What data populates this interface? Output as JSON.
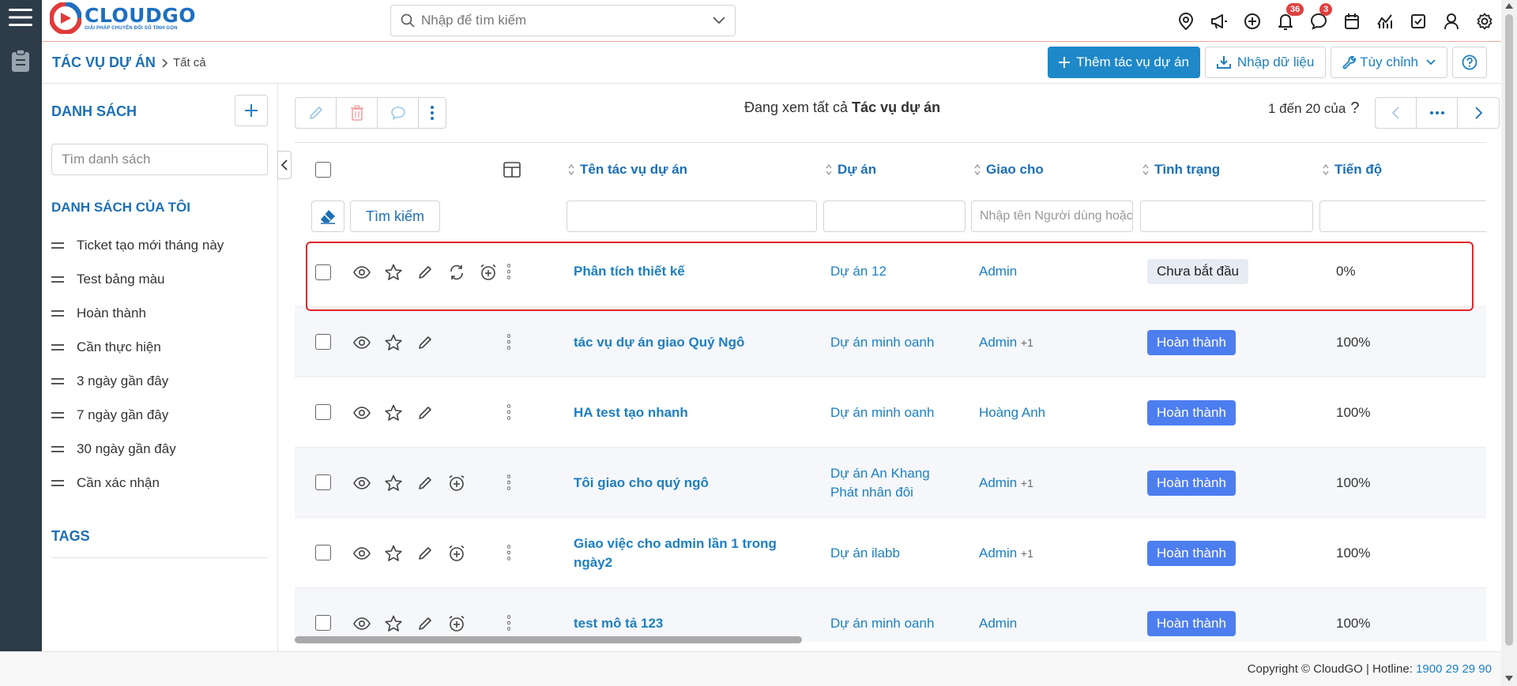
{
  "app": {
    "logo_title": "CLOUDGO",
    "logo_subtitle": "GIẢI PHÁP CHUYỂN ĐỔI SỐ TINH GỌN"
  },
  "header": {
    "search_placeholder": "Nhập để tìm kiếm",
    "icons": [
      "location-icon",
      "megaphone-icon",
      "add-circle-icon",
      "bell-icon",
      "chat-icon",
      "calendar-icon",
      "chart-icon",
      "checkbox-icon",
      "user-icon",
      "gear-icon"
    ],
    "notification_count": "36",
    "message_count": "3"
  },
  "breadcrumb": {
    "module": "TÁC VỤ DỰ ÁN",
    "current": "Tất cả"
  },
  "actions": {
    "add": "Thêm tác vụ dự án",
    "import": "Nhập dữ liệu",
    "customize": "Tùy chỉnh"
  },
  "sidebar": {
    "title": "DANH SÁCH",
    "search_placeholder": "Tìm danh sách",
    "my_lists_title": "DANH SÁCH CỦA TÔI",
    "items": [
      {
        "label": "Ticket tạo mới tháng này"
      },
      {
        "label": "Test bảng màu"
      },
      {
        "label": "Hoàn thành"
      },
      {
        "label": "Cần thực hiện"
      },
      {
        "label": "3 ngày gần đây"
      },
      {
        "label": "7 ngày gần đây"
      },
      {
        "label": "30 ngày gần đây"
      },
      {
        "label": "Cần xác nhận"
      }
    ],
    "tags_title": "TAGS"
  },
  "list": {
    "viewing_prefix": "Đang xem tất cả",
    "viewing_entity": "Tác vụ dự án",
    "pagination": "1 đến 20 của",
    "pagination_help": "?",
    "columns": {
      "name": "Tên tác vụ dự án",
      "project": "Dự án",
      "assignee": "Giao cho",
      "status": "Tình trạng",
      "progress": "Tiến độ"
    },
    "filter": {
      "search_button": "Tìm kiếm",
      "assignee_placeholder": "Nhập tên Người dùng hoặc nhóm"
    },
    "rows": [
      {
        "name": "Phân tích thiết kế",
        "project": "Dự án 12",
        "assignee": "Admin",
        "assignee_extra": "",
        "status": "Chưa bắt đầu",
        "progress": "0%"
      },
      {
        "name": "tác vụ dự án giao Quý Ngô",
        "project": "Dự án minh oanh",
        "assignee": "Admin",
        "assignee_extra": "+1",
        "status": "Hoàn thành",
        "progress": "100%"
      },
      {
        "name": "HA test tạo nhanh",
        "project": "Dự án minh oanh",
        "assignee": "Hoàng Anh",
        "assignee_extra": "",
        "status": "Hoàn thành",
        "progress": "100%"
      },
      {
        "name": "Tôi giao cho quý ngô",
        "project": "Dự án An Khang Phát nhân đôi",
        "assignee": "Admin",
        "assignee_extra": "+1",
        "status": "Hoàn thành",
        "progress": "100%"
      },
      {
        "name": "Giao việc cho admin lần 1 trong ngày2",
        "project": "Dự án ilabb",
        "assignee": "Admin",
        "assignee_extra": "+1",
        "status": "Hoàn thành",
        "progress": "100%"
      },
      {
        "name": "test mô tả 123",
        "project": "Dự án minh oanh",
        "assignee": "Admin",
        "assignee_extra": "",
        "status": "Hoàn thành",
        "progress": "100%"
      }
    ]
  },
  "footer": {
    "copyright": "Copyright © CloudGO",
    "hotline_label": "Hotline:",
    "hotline": "1900 29 29 90"
  },
  "colors": {
    "accent": "#1d7fc1",
    "primary_button": "#1e88c9",
    "rail": "#2e3b49",
    "done": "#4d7ef0",
    "highlight": "#e2252b"
  }
}
